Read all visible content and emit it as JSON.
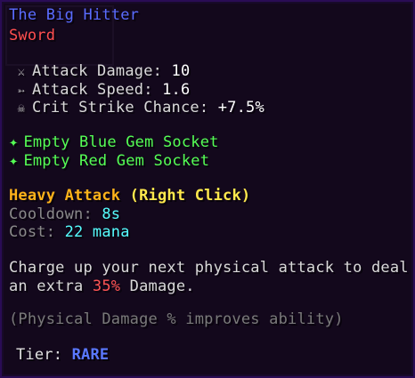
{
  "item": {
    "name": "The Big Hitter",
    "type": "Sword"
  },
  "stats": [
    {
      "icon": "swords-icon",
      "glyph": "⚔",
      "label": "Attack Damage: ",
      "value": "10"
    },
    {
      "icon": "attack-speed-icon",
      "glyph": "➳",
      "label": "Attack Speed: ",
      "value": "1.6"
    },
    {
      "icon": "skull-icon",
      "glyph": "☠",
      "label": "Crit Strike Chance: ",
      "value": "+7.5%"
    }
  ],
  "sockets": [
    {
      "bullet": "✦",
      "label": "Empty Blue Gem Socket"
    },
    {
      "bullet": "✦",
      "label": "Empty Red Gem Socket"
    }
  ],
  "ability": {
    "name": "Heavy Attack",
    "trigger": "(Right Click)",
    "cooldown_label": "Cooldown: ",
    "cooldown_value": "8s",
    "cost_label": "Cost: ",
    "cost_value": "22 mana",
    "desc_line1": "Charge up your next physical attack to deal",
    "desc_line2_pre": "an extra ",
    "desc_line2_pct": "35%",
    "desc_line2_post": " Damage.",
    "note": "(Physical Damage % improves ability)"
  },
  "tier": {
    "label": "Tier: ",
    "value": "RARE"
  },
  "colors": {
    "name": "#5a6cff",
    "type": "#ff4f4f",
    "socket": "#55ff55",
    "ability": "#ffb31a",
    "cyan": "#55ffff",
    "rare": "#5a78ff"
  }
}
